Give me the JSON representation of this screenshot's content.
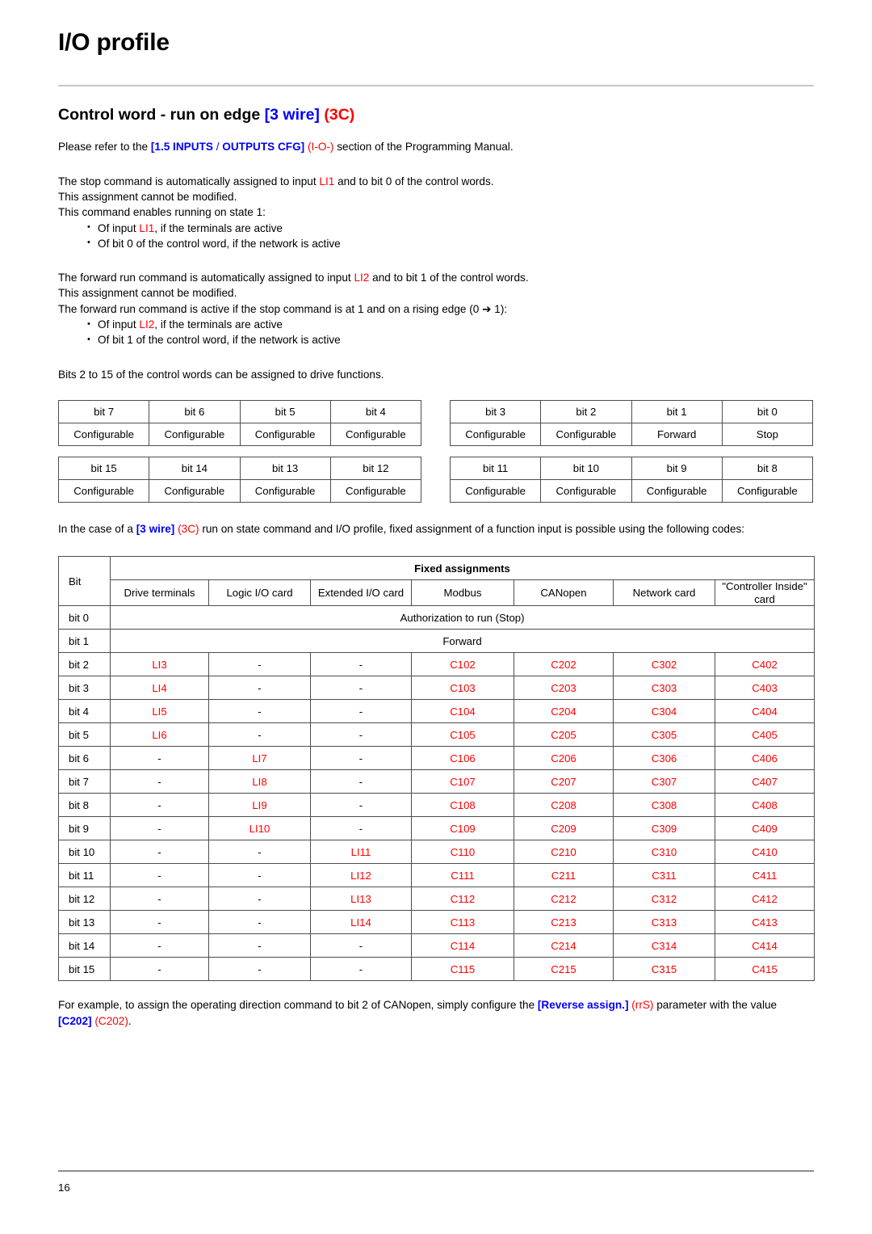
{
  "document": {
    "page_title": "I/O profile",
    "section_title": {
      "plain_1": "Control word - run on edge ",
      "blue_1": "[3 wire]",
      "red_1": "(3C)"
    },
    "footer_page_number": "16"
  },
  "intro": {
    "refer_prefix": "Please refer to the ",
    "refer_blue_1": "[1.5 INPUTS",
    "refer_slash": " / ",
    "refer_blue_2": "OUTPUTS CFG]",
    "refer_red": "(I-O-)",
    "refer_suffix": " section of the Programming Manual."
  },
  "stop_block": {
    "line1_a": "The stop command is automatically assigned to input ",
    "line1_red": "LI1",
    "line1_b": " and to bit 0 of the control words.",
    "line2": "This assignment cannot be modified.",
    "line3": "This command enables running on state 1:",
    "bullet1_a": "Of input ",
    "bullet1_red": "LI1",
    "bullet1_b": ", if the terminals are active",
    "bullet2": "Of bit 0 of the control word, if the network is active"
  },
  "forward_block": {
    "line1_a": "The forward run command is automatically assigned to input ",
    "line1_red": "LI2",
    "line1_b": " and to bit 1 of the control words.",
    "line2": "This assignment cannot be modified.",
    "line3": "The forward run command is active if the stop command is at 1 and on a rising edge (0 ➔ 1):",
    "bullet1_a": "Of input ",
    "bullet1_red": "LI2",
    "bullet1_b": ", if the terminals are active",
    "bullet2": "Of bit 1 of the control word, if the network is active"
  },
  "bits_note": "Bits 2 to 15 of the control words can be assigned to drive functions.",
  "bit_tables": {
    "top_left": {
      "headers": [
        "bit 7",
        "bit 6",
        "bit 5",
        "bit 4"
      ],
      "values": [
        "Configurable",
        "Configurable",
        "Configurable",
        "Configurable"
      ]
    },
    "top_right": {
      "headers": [
        "bit 3",
        "bit 2",
        "bit 1",
        "bit 0"
      ],
      "values": [
        "Configurable",
        "Configurable",
        "Forward",
        "Stop"
      ]
    },
    "bottom_left": {
      "headers": [
        "bit 15",
        "bit 14",
        "bit 13",
        "bit 12"
      ],
      "values": [
        "Configurable",
        "Configurable",
        "Configurable",
        "Configurable"
      ]
    },
    "bottom_right": {
      "headers": [
        "bit 11",
        "bit 10",
        "bit 9",
        "bit 8"
      ],
      "values": [
        "Configurable",
        "Configurable",
        "Configurable",
        "Configurable"
      ]
    }
  },
  "case_note": {
    "prefix": "In the case of a ",
    "blue": "[3 wire]",
    "red": "(3C)",
    "suffix": " run on state command and I/O profile, fixed assignment of a function input is possible using the following codes:"
  },
  "assign_table": {
    "bit_header": "Bit",
    "group_header": "Fixed assignments",
    "columns": [
      "Drive terminals",
      "Logic I/O card",
      "Extended I/O card",
      "Modbus",
      "CANopen",
      "Network card",
      "\"Controller Inside\" card"
    ],
    "spanned_rows": [
      {
        "bit": "bit  0",
        "text": "Authorization to run (Stop)"
      },
      {
        "bit": "bit  1",
        "text": "Forward"
      }
    ],
    "rows": [
      {
        "bit": "bit  2",
        "cells": [
          "LI3",
          "-",
          "-",
          "C102",
          "C202",
          "C302",
          "C402"
        ],
        "red": [
          true,
          false,
          false,
          true,
          true,
          true,
          true
        ]
      },
      {
        "bit": "bit  3",
        "cells": [
          "LI4",
          "-",
          "-",
          "C103",
          "C203",
          "C303",
          "C403"
        ],
        "red": [
          true,
          false,
          false,
          true,
          true,
          true,
          true
        ]
      },
      {
        "bit": "bit  4",
        "cells": [
          "LI5",
          "-",
          "-",
          "C104",
          "C204",
          "C304",
          "C404"
        ],
        "red": [
          true,
          false,
          false,
          true,
          true,
          true,
          true
        ]
      },
      {
        "bit": "bit  5",
        "cells": [
          "LI6",
          "-",
          "-",
          "C105",
          "C205",
          "C305",
          "C405"
        ],
        "red": [
          true,
          false,
          false,
          true,
          true,
          true,
          true
        ]
      },
      {
        "bit": "bit  6",
        "cells": [
          "-",
          "LI7",
          "-",
          "C106",
          "C206",
          "C306",
          "C406"
        ],
        "red": [
          false,
          true,
          false,
          true,
          true,
          true,
          true
        ]
      },
      {
        "bit": "bit  7",
        "cells": [
          "-",
          "LI8",
          "-",
          "C107",
          "C207",
          "C307",
          "C407"
        ],
        "red": [
          false,
          true,
          false,
          true,
          true,
          true,
          true
        ]
      },
      {
        "bit": "bit  8",
        "cells": [
          "-",
          "LI9",
          "-",
          "C108",
          "C208",
          "C308",
          "C408"
        ],
        "red": [
          false,
          true,
          false,
          true,
          true,
          true,
          true
        ]
      },
      {
        "bit": "bit  9",
        "cells": [
          "-",
          "LI10",
          "-",
          "C109",
          "C209",
          "C309",
          "C409"
        ],
        "red": [
          false,
          true,
          false,
          true,
          true,
          true,
          true
        ]
      },
      {
        "bit": "bit 10",
        "cells": [
          "-",
          "-",
          "LI11",
          "C110",
          "C210",
          "C310",
          "C410"
        ],
        "red": [
          false,
          false,
          true,
          true,
          true,
          true,
          true
        ]
      },
      {
        "bit": "bit 11",
        "cells": [
          "-",
          "-",
          "LI12",
          "C111",
          "C211",
          "C311",
          "C411"
        ],
        "red": [
          false,
          false,
          true,
          true,
          true,
          true,
          true
        ]
      },
      {
        "bit": "bit 12",
        "cells": [
          "-",
          "-",
          "LI13",
          "C112",
          "C212",
          "C312",
          "C412"
        ],
        "red": [
          false,
          false,
          true,
          true,
          true,
          true,
          true
        ]
      },
      {
        "bit": "bit 13",
        "cells": [
          "-",
          "-",
          "LI14",
          "C113",
          "C213",
          "C313",
          "C413"
        ],
        "red": [
          false,
          false,
          true,
          true,
          true,
          true,
          true
        ]
      },
      {
        "bit": "bit 14",
        "cells": [
          "-",
          "-",
          "-",
          "C114",
          "C214",
          "C314",
          "C414"
        ],
        "red": [
          false,
          false,
          false,
          true,
          true,
          true,
          true
        ]
      },
      {
        "bit": "bit 15",
        "cells": [
          "-",
          "-",
          "-",
          "C115",
          "C215",
          "C315",
          "C415"
        ],
        "red": [
          false,
          false,
          false,
          true,
          true,
          true,
          true
        ]
      }
    ]
  },
  "example_note": {
    "prefix": "For example, to assign the operating direction command to bit 2 of CANopen, simply configure the ",
    "blue_1": "[Reverse assign.]",
    "red_1": "(rrS)",
    "middle": " parameter with the value ",
    "blue_2": "[C202]",
    "red_2": "(C202)",
    "suffix": "."
  },
  "colors": {
    "blue": "#0000FF",
    "red": "#FF0000",
    "rule": "#C6C6C6",
    "border": "#4D4D4D"
  }
}
